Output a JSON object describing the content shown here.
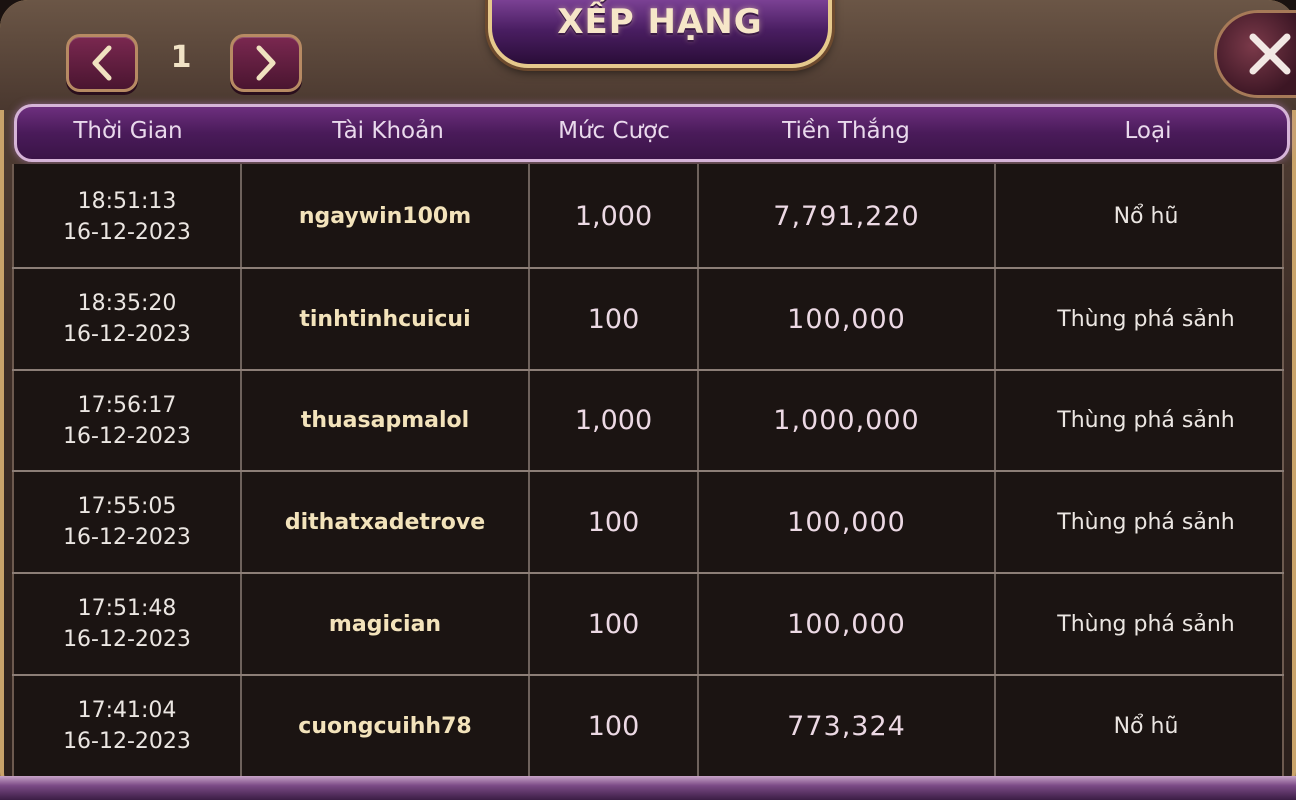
{
  "title": "XẾP HẠNG",
  "pager": {
    "page": "1",
    "prev_icon": "chevron-left-icon",
    "next_icon": "chevron-right-icon"
  },
  "close_icon": "close-icon",
  "colors": {
    "accent_purple": "#4a1b5a",
    "gold": "#e6c98c",
    "text_user": "#f3e3bb"
  },
  "table": {
    "headers": [
      "Thời Gian",
      "Tài Khoản",
      "Mức Cược",
      "Tiền Thắng",
      "Loại"
    ],
    "rows": [
      {
        "time": "18:51:13",
        "date": "16-12-2023",
        "user": "ngaywin100m",
        "bet": "1,000",
        "win": "7,791,220",
        "type": "Nổ hũ"
      },
      {
        "time": "18:35:20",
        "date": "16-12-2023",
        "user": "tinhtinhcuicui",
        "bet": "100",
        "win": "100,000",
        "type": "Thùng phá sảnh"
      },
      {
        "time": "17:56:17",
        "date": "16-12-2023",
        "user": "thuasapmalol",
        "bet": "1,000",
        "win": "1,000,000",
        "type": "Thùng phá sảnh"
      },
      {
        "time": "17:55:05",
        "date": "16-12-2023",
        "user": "dithatxadetrove",
        "bet": "100",
        "win": "100,000",
        "type": "Thùng phá sảnh"
      },
      {
        "time": "17:51:48",
        "date": "16-12-2023",
        "user": "magician",
        "bet": "100",
        "win": "100,000",
        "type": "Thùng phá sảnh"
      },
      {
        "time": "17:41:04",
        "date": "16-12-2023",
        "user": "cuongcuihh78",
        "bet": "100",
        "win": "773,324",
        "type": "Nổ hũ"
      }
    ]
  }
}
